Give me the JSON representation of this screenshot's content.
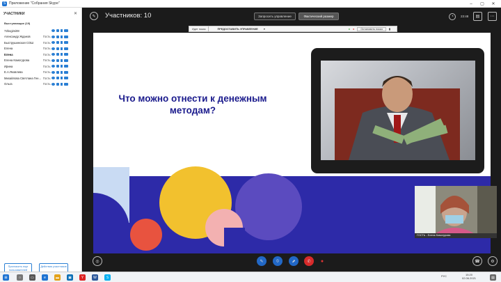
{
  "window": {
    "title": "Приложение \"Собрания Skype\""
  },
  "sidebar": {
    "header": "УЧАСТНИКИ",
    "close": "✕",
    "section": "Выступающие (19)",
    "participants": [
      {
        "name": "72bogimi08",
        "role": "",
        "bold": false
      },
      {
        "name": "Александр Жданов",
        "role": "Гость",
        "bold": false
      },
      {
        "name": "Быструшинская СОШ",
        "role": "Гость",
        "bold": false
      },
      {
        "name": "Елена",
        "role": "Гость",
        "bold": false
      },
      {
        "name": "Елена",
        "role": "Гость",
        "bold": true
      },
      {
        "name": "Елена Комогурова",
        "role": "Гость",
        "bold": false
      },
      {
        "name": "Ирина",
        "role": "Гость",
        "bold": false
      },
      {
        "name": "Е.А.Яковлева",
        "role": "Гость",
        "bold": false
      },
      {
        "name": "Михайлова Светлана Ген...",
        "role": "Гость",
        "bold": false
      },
      {
        "name": "Ольга",
        "role": "Гость",
        "bold": false
      }
    ],
    "invite_button": "Пригласить еще пользователей",
    "actions_button": "Действия участников"
  },
  "topbar": {
    "title": "Участников: 10",
    "request_control": "Запросить управление",
    "actual_size": "Фактический размер",
    "time": "23:48"
  },
  "sharebar": {
    "presenting": "Идет показ",
    "give_control": "ПРЕДОСТАВИТЬ УПРАВЛЕНИЕ",
    "dropdown": "▾",
    "stop_sharing": "Остановить показ"
  },
  "slide": {
    "title": "Что можно отнести к денежным методам?"
  },
  "webcam": {
    "caption": "ГОСТЬ - Елена Комогурова"
  },
  "taskbar": {
    "lang": "РУС",
    "time": "15:20",
    "date": "02.06.2021"
  },
  "colors": {
    "accent": "#2268c6",
    "slide_title": "#1a1a8c",
    "navy_band": "#2d2aa8",
    "yellow": "#f2c12e",
    "purple": "#5b4bbf",
    "red": "#e8533f",
    "pink": "#f3b1b1",
    "light_blue": "#c9dbf3"
  }
}
